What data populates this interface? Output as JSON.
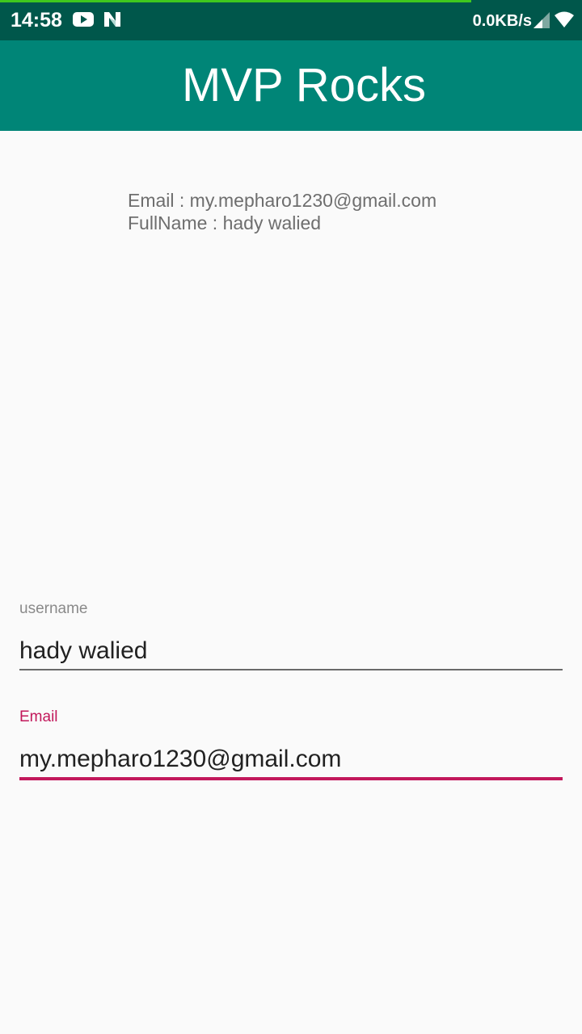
{
  "status_bar": {
    "time": "14:58",
    "network_speed": "0.0KB/s",
    "progress_fraction": 0.81,
    "icons": [
      "youtube-icon",
      "n-app-icon",
      "signal-icon",
      "wifi-icon"
    ]
  },
  "app_bar": {
    "title": "MVP Rocks"
  },
  "info": {
    "email_line": "Email : my.mepharo1230@gmail.com",
    "fullname_line": "FullName : hady walied"
  },
  "form": {
    "username": {
      "label": "username",
      "value": "hady walied"
    },
    "email": {
      "label": "Email",
      "value": "my.mepharo1230@gmail.com"
    }
  },
  "colors": {
    "status_bar": "#00574b",
    "app_bar": "#008577",
    "accent": "#c2185b",
    "background": "#fafafa"
  }
}
